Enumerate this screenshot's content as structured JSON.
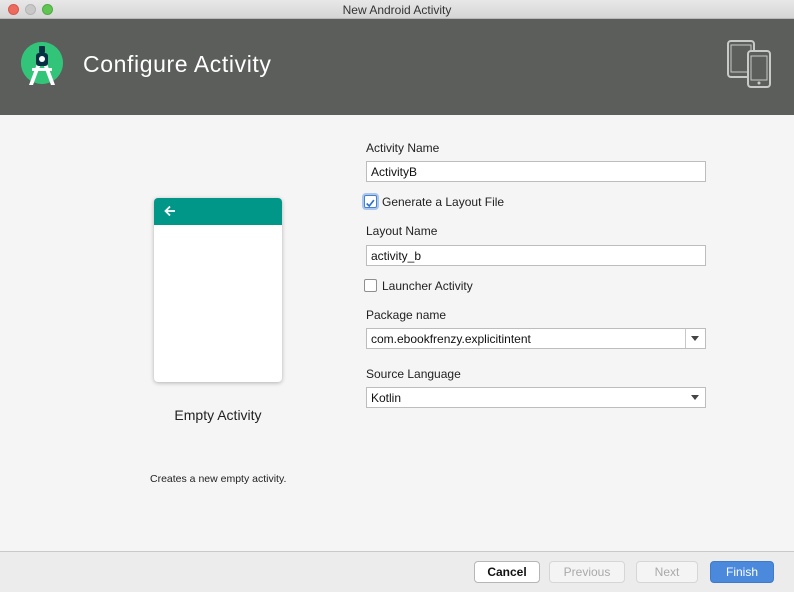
{
  "window": {
    "title": "New Android Activity"
  },
  "header": {
    "title": "Configure Activity",
    "logo_icon": "android-studio-icon",
    "device_icon": "phone-tablet-icon",
    "background": "#5c5e5c"
  },
  "preview": {
    "label": "Empty Activity",
    "description": "Creates a new empty activity.",
    "appbar_color": "#009688",
    "nav_icon": "back-arrow-icon"
  },
  "form": {
    "activity_name": {
      "label": "Activity Name",
      "value": "ActivityB"
    },
    "generate_layout": {
      "label": "Generate a Layout File",
      "checked": true
    },
    "layout_name": {
      "label": "Layout Name",
      "value": "activity_b"
    },
    "launcher_activity": {
      "label": "Launcher Activity",
      "checked": false
    },
    "package_name": {
      "label": "Package name",
      "value": "com.ebookfrenzy.explicitintent"
    },
    "source_language": {
      "label": "Source Language",
      "value": "Kotlin"
    }
  },
  "footer": {
    "cancel": "Cancel",
    "previous": "Previous",
    "next": "Next",
    "finish": "Finish",
    "accent": "#4a89dc"
  }
}
